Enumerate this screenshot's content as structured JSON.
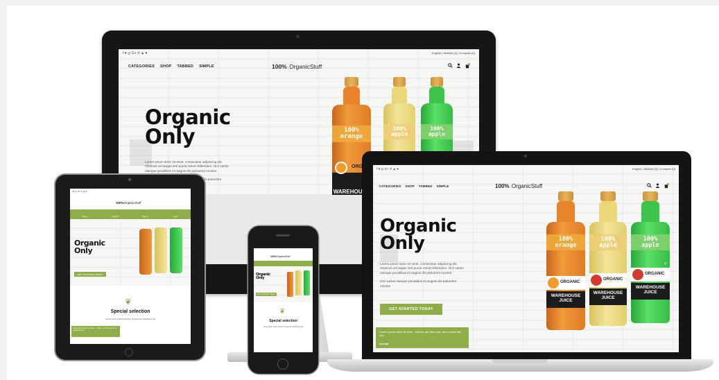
{
  "site": {
    "social_icons": "f ♥ ◎ G+ ℗ ▲ ♥",
    "top_right": {
      "language": "English",
      "wishlist": "Wishlist (0)",
      "compare": "Compare (0)"
    },
    "nav": [
      "CATEGORIES",
      "SHOP",
      "TABBED",
      "SIMPLE"
    ],
    "logo_main": "100%",
    "logo_small": "...",
    "logo_name": "OrganicStuff",
    "hero_title_line1": "Organic",
    "hero_title_line2": "Only",
    "lorem1": "Lorem ipsum dolor sit amet, consectetur adipiscing elit.",
    "lorem2": "Vivamus vel augue sed purus rutrum bibendum. Orci varius",
    "lorem3": "natoque penatibus et magnis dis parturient montes",
    "lorem4": "Orci varius natoque penatibus et magnis dis parturient",
    "lorem5": "montes",
    "cta": "GET STARTED TODAY",
    "cookie_text": "Lorem ipsum dolor sit amet - enable, put here your own cookie law text",
    "cookie_accept": "Accept",
    "special_title": "Special selection",
    "special_lines": "Lorem ipsum dolor sit amet, consectetur adipiscing elit",
    "tablet_tabs": [
      "Menu",
      "Search",
      "Sign in",
      "Cart"
    ],
    "bottles": {
      "orange": {
        "line1": "100%",
        "line2": "orange"
      },
      "apple": {
        "line1": "100%",
        "line2": "apple"
      },
      "green": {
        "line1": "100%",
        "line2": "apple"
      },
      "brand": "ORGANIC",
      "band_line1": "WAREHOUSE",
      "band_line2": "JUICE"
    }
  },
  "colors": {
    "accent": "#8fae4a",
    "orange_juice": "#e8852a",
    "apple_juice": "#ead77a",
    "green_juice": "#3cc44a",
    "cap": "#e0a94e"
  }
}
